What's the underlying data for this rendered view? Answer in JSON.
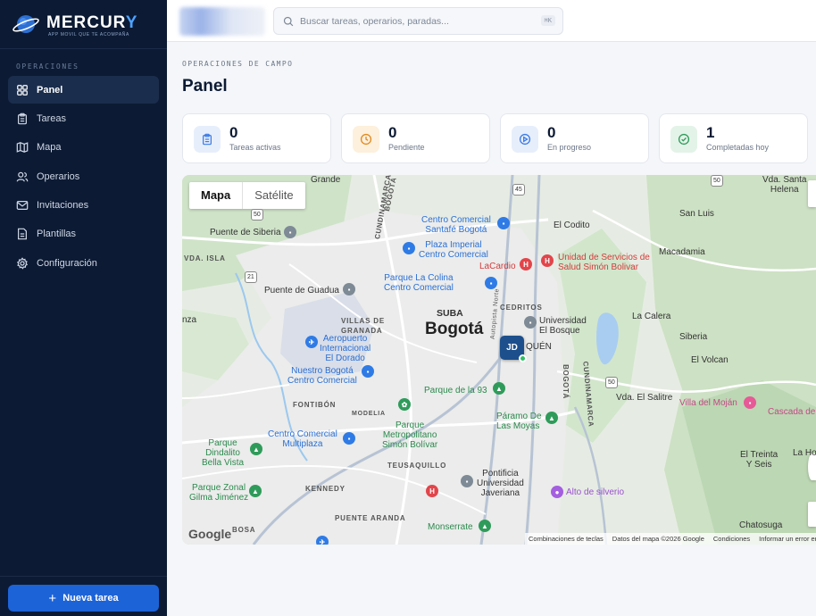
{
  "brand": {
    "name_main": "MERCUR",
    "name_accent": "Y",
    "tagline": "APP MOVIL QUE TE ACOMPAÑA"
  },
  "sidebar": {
    "section_label": "OPERACIONES",
    "items": [
      {
        "label": "Panel",
        "icon": "dashboard-icon",
        "active": true
      },
      {
        "label": "Tareas",
        "icon": "clipboard-icon",
        "active": false
      },
      {
        "label": "Mapa",
        "icon": "map-icon",
        "active": false
      },
      {
        "label": "Operarios",
        "icon": "users-icon",
        "active": false
      },
      {
        "label": "Invitaciones",
        "icon": "mail-icon",
        "active": false
      },
      {
        "label": "Plantillas",
        "icon": "document-icon",
        "active": false
      },
      {
        "label": "Configuración",
        "icon": "gear-icon",
        "active": false
      }
    ],
    "new_task_label": "Nueva tarea"
  },
  "topbar": {
    "search_placeholder": "Buscar tareas, operarios, paradas...",
    "search_value": "",
    "shortcut": "⌘K"
  },
  "main": {
    "eyebrow": "OPERACIONES DE CAMPO",
    "title": "Panel",
    "stats": [
      {
        "value": "0",
        "label": "Tareas activas",
        "icon": "clipboard-icon",
        "color": "#3b7be6",
        "bg": "#e7eefb"
      },
      {
        "value": "0",
        "label": "Pendiente",
        "icon": "clock-icon",
        "color": "#e08a1e",
        "bg": "#fdf0dc"
      },
      {
        "value": "0",
        "label": "En progreso",
        "icon": "play-icon",
        "color": "#3b7be6",
        "bg": "#e7eefb"
      },
      {
        "value": "1",
        "label": "Completadas hoy",
        "icon": "check-icon",
        "color": "#2f9b5a",
        "bg": "#e3f3e8"
      }
    ]
  },
  "map": {
    "tabs": [
      "Mapa",
      "Satélite"
    ],
    "active_tab": "Mapa",
    "city": "Bogotá",
    "operator_initials": "JD",
    "labels": {
      "grande": "Grande",
      "vda_santa_helena": "Vda. Santa\nHelena",
      "el_codito": "El Codito",
      "san_luis": "San Luis",
      "puente_siberia": "Puente de Siberia",
      "macadamia": "Macadamia",
      "vda_isla": "VDA. ISLA",
      "la_cardio": "LaCardio",
      "unidad_servicios": "Unidad de Servicios de\nSalud Simón Bolivar",
      "puente_guadua": "Puente de Guadua",
      "suba": "SUBA",
      "cedritos": "CEDRITOS",
      "universidad_bosque": "Universidad\nEl Bosque",
      "la_calera": "La Calera",
      "nza": "nza",
      "villas_granada": "VILLAS DE\nGRANADA",
      "aeropuerto": "Aeropuerto\nInternacional\nEl Dorado",
      "quen": "QUÉN",
      "siberia": "Siberia",
      "el_volcan": "El Volcan",
      "nuestro_bogota": "Nuestro Bogotá\nCentro Comercial",
      "fontibon": "FONTIBÓN",
      "modelia": "MODELIA",
      "parque_93": "Parque de la 93",
      "vda_el_salitre": "Vda. El Salitre",
      "villa_mojan": "Villa del Moján",
      "cascada": "Cascada de",
      "paramo_moyas": "Páramo De\nLas Moyas",
      "parque_dindalito": "Parque\nDindalito\nBella Vista",
      "centro_multiplaza": "Centro Comercial\nMultiplaza",
      "parque_metropolitano": "Parque\nMetropolitano\nSimón Bolívar",
      "teusaquillo": "TEUSAQUILLO",
      "el_treinta": "El Treinta\nY Seis",
      "la_ho": "La Ho",
      "parque_zonal": "Parque Zonal\nGilma Jiménez",
      "kennedy": "KENNEDY",
      "pontificia": "Pontificia\nUniversidad\nJaveriana",
      "alto_silverio": "Alto de silverio",
      "puente_aranda": "PUENTE ARANDA",
      "bosa": "BOSA",
      "monserrate": "Monserrate",
      "chatosuga": "Chatosuga",
      "centro_santafe": "Centro Comercial\nSantafé Bogotá",
      "plaza_imperial": "Plaza Imperial\nCentro Comercial",
      "parque_colina": "Parque La Colina\nCentro Comercial",
      "road_cundinamarca_1": "CUNDINAMARCA",
      "road_bogota_1": "BOGOTÁ",
      "road_autopista": "Autopista Norte",
      "road_bogota_2": "BOGOTÁ",
      "road_cundinamarca_2": "CUNDINAMARCA",
      "shield_50": "50",
      "shield_21": "21",
      "shield_45": "45",
      "shield_50b": "50",
      "shield_50c": "50"
    },
    "google": "Google",
    "attribution": [
      "Combinaciones de teclas",
      "Datos del mapa ©2026 Google",
      "Condiciones",
      "Informar un error en e"
    ]
  }
}
